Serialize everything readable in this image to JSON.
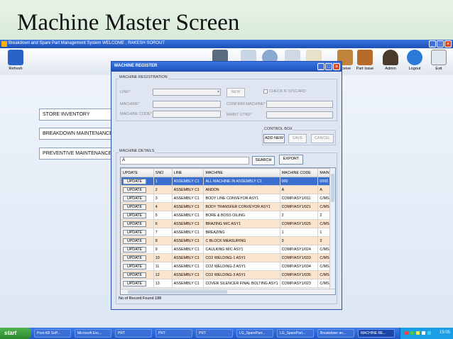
{
  "slide": {
    "title": "Machine Master Screen"
  },
  "app": {
    "title": "Breakdown and Spare Part Management System WELCOME , RAKESH SOROUT",
    "window_buttons": [
      "_",
      "□",
      "×"
    ],
    "toolbar_left": {
      "label": "Refresh"
    },
    "toolbar_right": [
      {
        "label": "eceive"
      },
      {
        "label": "Part Issue"
      },
      {
        "label": "Admin"
      },
      {
        "label": "Logout"
      },
      {
        "label": "Exit"
      }
    ],
    "nav": [
      "STORE INVENTORY",
      "BREAKDOWN MAINTENANCE",
      "PREVENTIVE MAINTENANCE"
    ]
  },
  "dialog": {
    "title": "MACHINE REGISTER",
    "registration": {
      "legend": "MACHINE REGISTRATION",
      "line_label": "LINE*",
      "new_button": "NEW",
      "check_discard": "CHECK IF DISCARD",
      "machine_label": "MACHINE*",
      "confirm_machine_label": "CONFIRM MACHINE*",
      "machine_code_label": "MACHINE CODE*",
      "maint_stnd_label": "MAINT STND*"
    },
    "control_box": {
      "legend": "CONTROL BOX",
      "add_new": "ADD NEW",
      "save": "SAVE",
      "cancel": "CANCEL"
    },
    "details": {
      "legend": "MACHINE DETAILS",
      "search_value": "A",
      "search_button": "SEARCH",
      "export_button": "EXPORT",
      "columns": [
        "UPDATE",
        "SNO",
        "LINE",
        "MACHINE",
        "MACHINE CODE",
        "MAIN S"
      ],
      "update_label": "UPDATE",
      "rows": [
        {
          "sno": "1",
          "line": "ASSEMBLY C1",
          "machine": "ALL MACHINE IN ASSEMBLY C1",
          "code": "000",
          "main": "0000"
        },
        {
          "sno": "2",
          "line": "ASSEMBLY C1",
          "machine": "ANDON",
          "code": "A",
          "main": "A"
        },
        {
          "sno": "3",
          "line": "ASSEMBLY C1",
          "machine": "BODY LINE CONVEYOR ASY1",
          "code": "COMP/ASY1/011",
          "main": "C/MS-A"
        },
        {
          "sno": "4",
          "line": "ASSEMBLY C1",
          "machine": "BODY TRANSFER CONVEYOR ASY1",
          "code": "COMP/ASY1/021",
          "main": "C/MS-A"
        },
        {
          "sno": "5",
          "line": "ASSEMBLY C1",
          "machine": "BORE & BOSS OILING",
          "code": "2",
          "main": "2"
        },
        {
          "sno": "6",
          "line": "ASSEMBLY C1",
          "machine": "BRAZING M/C ASY1",
          "code": "COMP/ASY1/025",
          "main": "C/MS-A"
        },
        {
          "sno": "7",
          "line": "ASSEMBLY C1",
          "machine": "BREAZING",
          "code": "1",
          "main": "1"
        },
        {
          "sno": "8",
          "line": "ASSEMBLY C1",
          "machine": "C BLOCK MEASURING",
          "code": "3",
          "main": "3"
        },
        {
          "sno": "9",
          "line": "ASSEMBLY C1",
          "machine": "CAULKING M/C ASY1",
          "code": "COMP/ASY1/024",
          "main": "C/MS-A"
        },
        {
          "sno": "10",
          "line": "ASSEMBLY C1",
          "machine": "CO2 WELDING-1 ASY1",
          "code": "COMP/ASY1/033",
          "main": "C/MS-A"
        },
        {
          "sno": "11",
          "line": "ASSEMBLY C1",
          "machine": "CO2 WELDING-2 ASY1",
          "code": "COMP/ASY1/034",
          "main": "C/MS-A"
        },
        {
          "sno": "12",
          "line": "ASSEMBLY C1",
          "machine": "CO2 WELDING-3 ASY1",
          "code": "COMP/ASY1/035",
          "main": "C/MS-A"
        },
        {
          "sno": "13",
          "line": "ASSEMBLY C1",
          "machine": "COVER SILENCER FINAL BOLTING ASY1",
          "code": "COMP/ASY1/023",
          "main": "C/MS-A"
        }
      ],
      "records_label": "No of Record Found 188"
    }
  },
  "taskbar": {
    "start": "start",
    "tasks": [
      "Post-KB SoP...",
      "Microsoft Exc...",
      "PRT",
      "PRT",
      "PRT",
      "LG_SparePart...",
      "LG_SparePart...",
      "Breakdown an...",
      "MACHINE RE..."
    ],
    "clock": "15:05"
  },
  "colors": {
    "title_bar": "#1c4fb6",
    "selected_row": "#3a6fd0",
    "odd_row": "#fbe5cf",
    "slide_border": "#2d7a2d"
  }
}
